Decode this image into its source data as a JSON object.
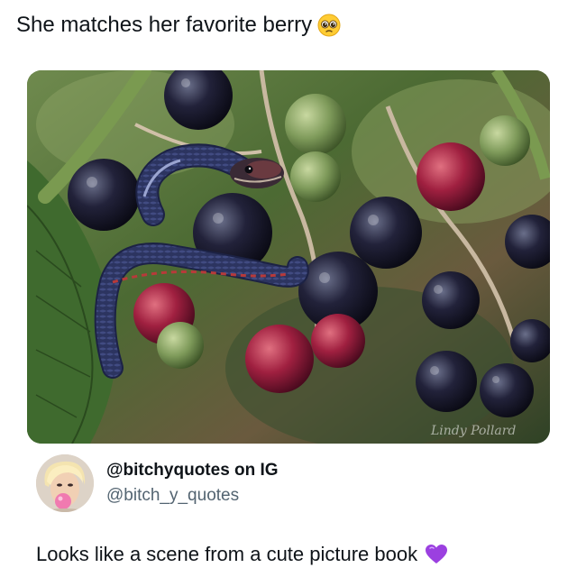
{
  "post": {
    "title": "She matches her favorite berry",
    "title_emoji": "pleading-face-emoji",
    "photo": {
      "watermark": "Lindy Pollard"
    }
  },
  "quoted_account": {
    "display_name": "@bitchyquotes on IG",
    "handle": "@bitch_y_quotes",
    "avatar": "avatar-image"
  },
  "caption": {
    "text": "Looks like a scene from a cute picture book",
    "emoji": "purple-heart-emoji",
    "emoji_color": "#9b40e0"
  }
}
